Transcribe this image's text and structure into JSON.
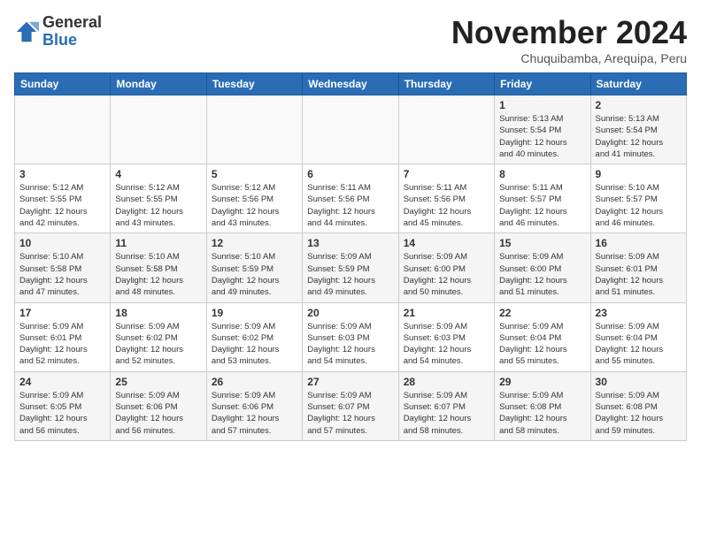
{
  "header": {
    "logo_line1": "General",
    "logo_line2": "Blue",
    "month_year": "November 2024",
    "location": "Chuquibamba, Arequipa, Peru"
  },
  "weekdays": [
    "Sunday",
    "Monday",
    "Tuesday",
    "Wednesday",
    "Thursday",
    "Friday",
    "Saturday"
  ],
  "weeks": [
    [
      {
        "day": "",
        "info": ""
      },
      {
        "day": "",
        "info": ""
      },
      {
        "day": "",
        "info": ""
      },
      {
        "day": "",
        "info": ""
      },
      {
        "day": "",
        "info": ""
      },
      {
        "day": "1",
        "info": "Sunrise: 5:13 AM\nSunset: 5:54 PM\nDaylight: 12 hours\nand 40 minutes."
      },
      {
        "day": "2",
        "info": "Sunrise: 5:13 AM\nSunset: 5:54 PM\nDaylight: 12 hours\nand 41 minutes."
      }
    ],
    [
      {
        "day": "3",
        "info": "Sunrise: 5:12 AM\nSunset: 5:55 PM\nDaylight: 12 hours\nand 42 minutes."
      },
      {
        "day": "4",
        "info": "Sunrise: 5:12 AM\nSunset: 5:55 PM\nDaylight: 12 hours\nand 43 minutes."
      },
      {
        "day": "5",
        "info": "Sunrise: 5:12 AM\nSunset: 5:56 PM\nDaylight: 12 hours\nand 43 minutes."
      },
      {
        "day": "6",
        "info": "Sunrise: 5:11 AM\nSunset: 5:56 PM\nDaylight: 12 hours\nand 44 minutes."
      },
      {
        "day": "7",
        "info": "Sunrise: 5:11 AM\nSunset: 5:56 PM\nDaylight: 12 hours\nand 45 minutes."
      },
      {
        "day": "8",
        "info": "Sunrise: 5:11 AM\nSunset: 5:57 PM\nDaylight: 12 hours\nand 46 minutes."
      },
      {
        "day": "9",
        "info": "Sunrise: 5:10 AM\nSunset: 5:57 PM\nDaylight: 12 hours\nand 46 minutes."
      }
    ],
    [
      {
        "day": "10",
        "info": "Sunrise: 5:10 AM\nSunset: 5:58 PM\nDaylight: 12 hours\nand 47 minutes."
      },
      {
        "day": "11",
        "info": "Sunrise: 5:10 AM\nSunset: 5:58 PM\nDaylight: 12 hours\nand 48 minutes."
      },
      {
        "day": "12",
        "info": "Sunrise: 5:10 AM\nSunset: 5:59 PM\nDaylight: 12 hours\nand 49 minutes."
      },
      {
        "day": "13",
        "info": "Sunrise: 5:09 AM\nSunset: 5:59 PM\nDaylight: 12 hours\nand 49 minutes."
      },
      {
        "day": "14",
        "info": "Sunrise: 5:09 AM\nSunset: 6:00 PM\nDaylight: 12 hours\nand 50 minutes."
      },
      {
        "day": "15",
        "info": "Sunrise: 5:09 AM\nSunset: 6:00 PM\nDaylight: 12 hours\nand 51 minutes."
      },
      {
        "day": "16",
        "info": "Sunrise: 5:09 AM\nSunset: 6:01 PM\nDaylight: 12 hours\nand 51 minutes."
      }
    ],
    [
      {
        "day": "17",
        "info": "Sunrise: 5:09 AM\nSunset: 6:01 PM\nDaylight: 12 hours\nand 52 minutes."
      },
      {
        "day": "18",
        "info": "Sunrise: 5:09 AM\nSunset: 6:02 PM\nDaylight: 12 hours\nand 52 minutes."
      },
      {
        "day": "19",
        "info": "Sunrise: 5:09 AM\nSunset: 6:02 PM\nDaylight: 12 hours\nand 53 minutes."
      },
      {
        "day": "20",
        "info": "Sunrise: 5:09 AM\nSunset: 6:03 PM\nDaylight: 12 hours\nand 54 minutes."
      },
      {
        "day": "21",
        "info": "Sunrise: 5:09 AM\nSunset: 6:03 PM\nDaylight: 12 hours\nand 54 minutes."
      },
      {
        "day": "22",
        "info": "Sunrise: 5:09 AM\nSunset: 6:04 PM\nDaylight: 12 hours\nand 55 minutes."
      },
      {
        "day": "23",
        "info": "Sunrise: 5:09 AM\nSunset: 6:04 PM\nDaylight: 12 hours\nand 55 minutes."
      }
    ],
    [
      {
        "day": "24",
        "info": "Sunrise: 5:09 AM\nSunset: 6:05 PM\nDaylight: 12 hours\nand 56 minutes."
      },
      {
        "day": "25",
        "info": "Sunrise: 5:09 AM\nSunset: 6:06 PM\nDaylight: 12 hours\nand 56 minutes."
      },
      {
        "day": "26",
        "info": "Sunrise: 5:09 AM\nSunset: 6:06 PM\nDaylight: 12 hours\nand 57 minutes."
      },
      {
        "day": "27",
        "info": "Sunrise: 5:09 AM\nSunset: 6:07 PM\nDaylight: 12 hours\nand 57 minutes."
      },
      {
        "day": "28",
        "info": "Sunrise: 5:09 AM\nSunset: 6:07 PM\nDaylight: 12 hours\nand 58 minutes."
      },
      {
        "day": "29",
        "info": "Sunrise: 5:09 AM\nSunset: 6:08 PM\nDaylight: 12 hours\nand 58 minutes."
      },
      {
        "day": "30",
        "info": "Sunrise: 5:09 AM\nSunset: 6:08 PM\nDaylight: 12 hours\nand 59 minutes."
      }
    ]
  ]
}
